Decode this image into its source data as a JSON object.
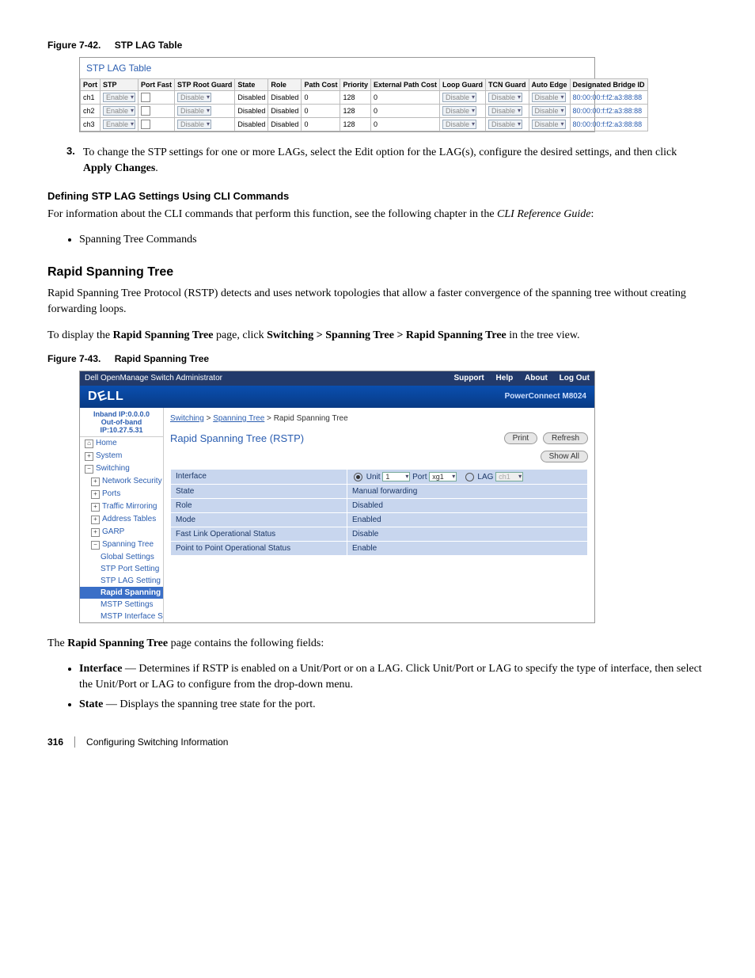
{
  "fig742": {
    "num": "Figure 7-42.",
    "title": "STP LAG Table"
  },
  "lagtable": {
    "title": "STP LAG Table",
    "headers": [
      "Port",
      "STP",
      "Port Fast",
      "STP Root Guard",
      "State",
      "Role",
      "Path Cost",
      "Priority",
      "External Path Cost",
      "Loop Guard",
      "TCN Guard",
      "Auto Edge",
      "Designated Bridge ID"
    ],
    "rows": [
      {
        "port": "ch1",
        "stp": "Enable",
        "guard": "Disable",
        "state": "Disabled",
        "role": "Disabled",
        "pcost": "0",
        "prio": "128",
        "ext": "0",
        "loop": "Disable",
        "tcn": "Disable",
        "auto": "Disable",
        "bridge": "80:00:00:f:f2:a3:88:88"
      },
      {
        "port": "ch2",
        "stp": "Enable",
        "guard": "Disable",
        "state": "Disabled",
        "role": "Disabled",
        "pcost": "0",
        "prio": "128",
        "ext": "0",
        "loop": "Disable",
        "tcn": "Disable",
        "auto": "Disable",
        "bridge": "80:00:00:f:f2:a3:88:88"
      },
      {
        "port": "ch3",
        "stp": "Enable",
        "guard": "Disable",
        "state": "Disabled",
        "role": "Disabled",
        "pcost": "0",
        "prio": "128",
        "ext": "0",
        "loop": "Disable",
        "tcn": "Disable",
        "auto": "Disable",
        "bridge": "80:00:00:f:f2:a3:88:88"
      }
    ]
  },
  "step3": {
    "num": "3.",
    "text_a": "To change the STP settings for one or more LAGs, select the Edit option for the LAG(s), configure the desired settings, and then click ",
    "text_b": "Apply Changes",
    "text_c": "."
  },
  "cli_heading": "Defining STP LAG Settings Using CLI Commands",
  "cli_p1a": "For information about the CLI commands that perform this function, see the following chapter in the ",
  "cli_p1b": "CLI Reference Guide",
  "cli_p1c": ":",
  "cli_bullet": "Spanning Tree Commands",
  "rstp_heading": "Rapid Spanning Tree",
  "rstp_p1": "Rapid Spanning Tree Protocol (RSTP) detects and uses network topologies that allow a faster convergence of the spanning tree without creating forwarding loops.",
  "rstp_p2a": "To display the ",
  "rstp_p2b": "Rapid Spanning Tree",
  "rstp_p2c": " page, click ",
  "rstp_p2d": "Switching > Spanning Tree > Rapid Spanning Tree",
  "rstp_p2e": " in the tree view.",
  "fig743": {
    "num": "Figure 7-43.",
    "title": "Rapid Spanning Tree"
  },
  "ss2": {
    "topbar_title": "Dell OpenManage Switch Administrator",
    "nav": [
      "Support",
      "Help",
      "About",
      "Log Out"
    ],
    "brand": "DELL",
    "model": "PowerConnect M8024",
    "ip1": "Inband IP:0.0.0.0",
    "ip2": "Out-of-band IP:10.27.5.31",
    "tree": {
      "home": "Home",
      "system": "System",
      "switching": "Switching",
      "netsec": "Network Security",
      "ports": "Ports",
      "traffic": "Traffic Mirroring",
      "addr": "Address Tables",
      "garp": "GARP",
      "stp": "Spanning Tree",
      "global": "Global Settings",
      "portset": "STP Port Setting",
      "lagset": "STP LAG Setting",
      "rapid": "Rapid Spanning",
      "mstp": "MSTP Settings",
      "mstpif": "MSTP Interface S"
    },
    "breadcrumb": {
      "a": "Switching",
      "b": "Spanning Tree",
      "c": "Rapid Spanning Tree",
      "sep": " > "
    },
    "panel_title": "Rapid Spanning Tree (RSTP)",
    "btn_print": "Print",
    "btn_refresh": "Refresh",
    "btn_showall": "Show All",
    "fields": {
      "iface": "Interface",
      "iface_unit": "Unit",
      "iface_unit_v": "1",
      "iface_port": "Port",
      "iface_port_v": "xg1",
      "iface_lag": "LAG",
      "iface_lag_v": "ch1",
      "state": "State",
      "state_v": "Manual forwarding",
      "role": "Role",
      "role_v": "Disabled",
      "mode": "Mode",
      "mode_v": "Enabled",
      "fast": "Fast Link Operational Status",
      "fast_v": "Disable",
      "p2p": "Point to Point Operational Status",
      "p2p_v": "Enable"
    }
  },
  "after_p_a": "The ",
  "after_p_b": "Rapid Spanning Tree",
  "after_p_c": " page contains the following fields:",
  "bul_iface_a": "Interface",
  "bul_iface_b": " — Determines if RSTP is enabled on a Unit/Port or on a LAG. Click Unit/Port or LAG to specify the type of interface, then select the Unit/Port or LAG to configure from the drop-down menu.",
  "bul_state_a": "State",
  "bul_state_b": " — Displays the spanning tree state for the port.",
  "footer": {
    "page": "316",
    "chapter": "Configuring Switching Information"
  }
}
